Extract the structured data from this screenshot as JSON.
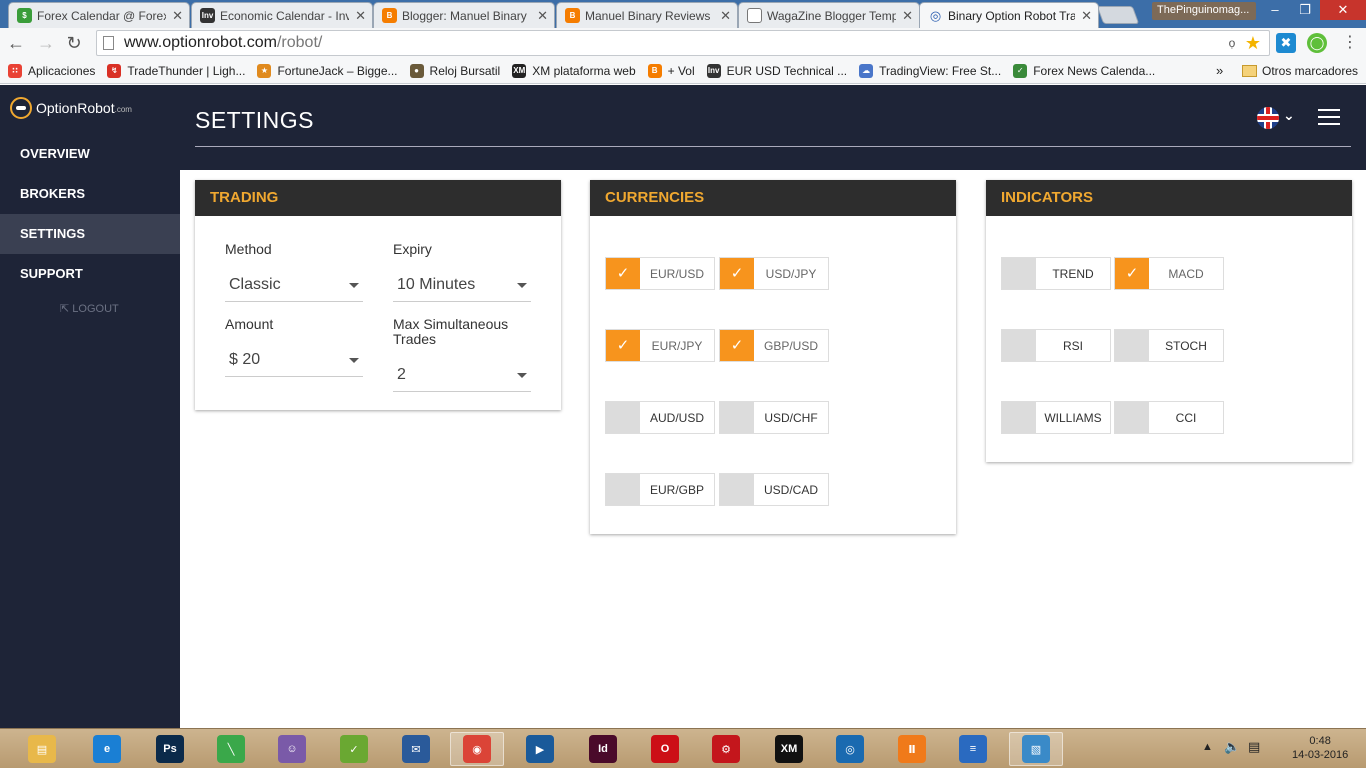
{
  "browser": {
    "tabs": [
      {
        "title": "Forex Calendar @ Forex",
        "color": "#3a9d3a",
        "glyph": "$"
      },
      {
        "title": "Economic Calendar - Inv",
        "color": "#333333",
        "glyph": "Inv"
      },
      {
        "title": "Blogger: Manuel Binary",
        "color": "#f57d00",
        "glyph": "B"
      },
      {
        "title": "Manuel Binary Reviews",
        "color": "#f57d00",
        "glyph": "B"
      },
      {
        "title": "WagaZine Blogger Temp",
        "color": "#ffffff",
        "glyph": ""
      },
      {
        "title": "Binary Option Robot Tra",
        "color": "#2a5db0",
        "glyph": "◎"
      }
    ],
    "profile_name": "ThePinguinomag...",
    "url_host": "www.optionrobot.com",
    "url_path": "/robot/",
    "bookmarks": [
      {
        "label": "Aplicaciones",
        "color": "#e94235",
        "glyph": "∷"
      },
      {
        "label": "TradeThunder | Ligh...",
        "color": "#d93025",
        "glyph": "↯"
      },
      {
        "label": "FortuneJack – Bigge...",
        "color": "#e08a1e",
        "glyph": "★"
      },
      {
        "label": "Reloj Bursatil",
        "color": "#6a5a3a",
        "glyph": "●"
      },
      {
        "label": "XM plataforma web",
        "color": "#222222",
        "glyph": "XM"
      },
      {
        "label": "+ Vol",
        "color": "#f57d00",
        "glyph": "B"
      },
      {
        "label": "EUR USD Technical ...",
        "color": "#333333",
        "glyph": "Inv"
      },
      {
        "label": "TradingView: Free St...",
        "color": "#4a76c9",
        "glyph": "☁"
      },
      {
        "label": "Forex News Calenda...",
        "color": "#3a8a3a",
        "glyph": "✓"
      }
    ],
    "more_bookmarks": "»",
    "other_bookmarks": "Otros marcadores"
  },
  "app": {
    "logo_text": "OptionRobot",
    "logo_suffix": ".com",
    "page_title": "SETTINGS",
    "nav": [
      "OVERVIEW",
      "BROKERS",
      "SETTINGS",
      "SUPPORT"
    ],
    "active_nav": "SETTINGS",
    "logout": "LOGOUT",
    "trading": {
      "heading": "TRADING",
      "method_label": "Method",
      "method_value": "Classic",
      "expiry_label": "Expiry",
      "expiry_value": "10 Minutes",
      "amount_label": "Amount",
      "amount_value": "$ 20",
      "max_label": "Max Simultaneous Trades",
      "max_value": "2"
    },
    "currencies": {
      "heading": "CURRENCIES",
      "items": [
        {
          "label": "EUR/USD",
          "checked": true
        },
        {
          "label": "USD/JPY",
          "checked": true
        },
        {
          "label": "EUR/JPY",
          "checked": true
        },
        {
          "label": "GBP/USD",
          "checked": true
        },
        {
          "label": "AUD/USD",
          "checked": false
        },
        {
          "label": "USD/CHF",
          "checked": false
        },
        {
          "label": "EUR/GBP",
          "checked": false
        },
        {
          "label": "USD/CAD",
          "checked": false
        }
      ]
    },
    "indicators": {
      "heading": "INDICATORS",
      "items": [
        {
          "label": "TREND",
          "checked": false
        },
        {
          "label": "MACD",
          "checked": true
        },
        {
          "label": "RSI",
          "checked": false
        },
        {
          "label": "STOCH",
          "checked": false
        },
        {
          "label": "WILLIAMS",
          "checked": false
        },
        {
          "label": "CCI",
          "checked": false
        }
      ]
    },
    "accent_color": "#f7941d"
  },
  "taskbar": {
    "apps": [
      {
        "name": "file-explorer",
        "glyph": "▤",
        "color": "#e8b84a"
      },
      {
        "name": "internet-explorer",
        "glyph": "e",
        "color": "#1a7fd4"
      },
      {
        "name": "photoshop",
        "glyph": "Ps",
        "color": "#0b2a4a"
      },
      {
        "name": "vector-app",
        "glyph": "╲",
        "color": "#3aa84a"
      },
      {
        "name": "pidgin",
        "glyph": "☺",
        "color": "#7a5aa8"
      },
      {
        "name": "spreadsheet",
        "glyph": "✓",
        "color": "#6aa832"
      },
      {
        "name": "thunderbird",
        "glyph": "✉",
        "color": "#2a5a9a"
      },
      {
        "name": "chrome",
        "glyph": "◉",
        "color": "#db4437"
      },
      {
        "name": "media-player",
        "glyph": "▶",
        "color": "#1a5a9a"
      },
      {
        "name": "indesign",
        "glyph": "Id",
        "color": "#4a0a2a"
      },
      {
        "name": "opera",
        "glyph": "O",
        "color": "#cc0f16"
      },
      {
        "name": "settings-app",
        "glyph": "⚙",
        "color": "#c4161c"
      },
      {
        "name": "xm",
        "glyph": "XM",
        "color": "#111111"
      },
      {
        "name": "speedtest",
        "glyph": "◎",
        "color": "#1a6ab0"
      },
      {
        "name": "charts-app",
        "glyph": "Ⅱ",
        "color": "#f07a1a"
      },
      {
        "name": "wordpad",
        "glyph": "≡",
        "color": "#2a6ac0"
      },
      {
        "name": "photos",
        "glyph": "▧",
        "color": "#3a8ac8"
      }
    ],
    "time": "0:48",
    "date": "14-03-2016"
  }
}
